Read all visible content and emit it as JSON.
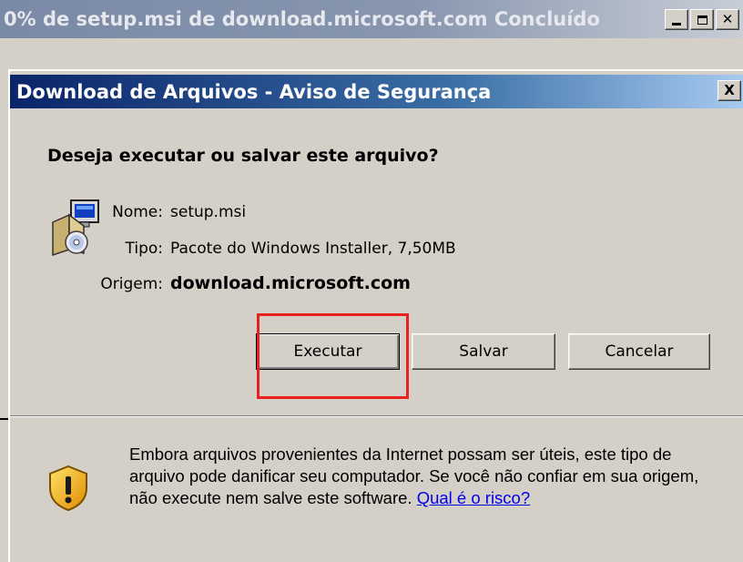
{
  "background_window": {
    "title": "0% de setup.msi de download.microsoft.com Concluído",
    "buttons": [
      "minimize",
      "maximize",
      "close"
    ]
  },
  "dialog": {
    "title": "Download de Arquivos - Aviso de Segurança",
    "close_label": "X",
    "question": "Deseja executar ou salvar este arquivo?",
    "file_icon": "installer-package-icon",
    "fields": {
      "name_label": "Nome:",
      "name_value": "setup.msi",
      "type_label": "Tipo:",
      "type_value": "Pacote do Windows Installer, 7,50MB",
      "origin_label": "Origem:",
      "origin_value": "download.microsoft.com"
    },
    "buttons": {
      "run": "Executar",
      "save": "Salvar",
      "cancel": "Cancelar"
    },
    "warning": {
      "icon": "shield-warning-icon",
      "text": "Embora arquivos provenientes da Internet possam ser úteis, este tipo de arquivo pode danificar seu computador. Se você não confiar em sua origem, não execute nem salve este software. ",
      "link": "Qual é o risco?"
    }
  },
  "colors": {
    "dialog_title_start": "#0a246a",
    "dialog_title_end": "#a6caf0",
    "highlight": "#e8201e",
    "face": "#d4d0c8",
    "link": "#0000ee"
  }
}
